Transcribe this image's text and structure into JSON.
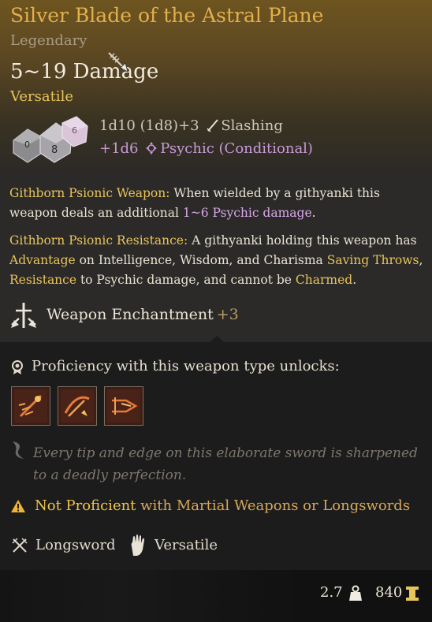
{
  "header": {
    "title": "Silver Blade of the Astral Plane",
    "rarity": "Legendary",
    "damage": "5~19 Damage",
    "tag": "Versatile",
    "damage_line1": {
      "dice": "1d10 (1d8)+3",
      "type": "Slashing"
    },
    "damage_line2": {
      "dice": "+1d6",
      "type": "Psychic (Conditional)"
    }
  },
  "passive1": {
    "name": "Githborn Psionic Weapon:",
    "text_a": " When wielded by a githyanki this weapon deals an additional ",
    "highlight": "1~6 Psychic damage",
    "text_b": "."
  },
  "passive2": {
    "name": "Githborn Psionic Resistance:",
    "text_a": " A githyanki holding this weapon has ",
    "kw_advantage": "Advantage",
    "text_b": " on Intelligence, Wisdom, and Charisma ",
    "kw_saving": "Saving Throws",
    "text_c": ", ",
    "kw_resistance": "Resistance",
    "text_d": " to Psychic damage, and cannot be ",
    "kw_charmed": "Charmed",
    "text_e": "."
  },
  "enchantment": {
    "label": "Weapon Enchantment",
    "value": "+3"
  },
  "proficiency": {
    "label": "Proficiency with this weapon type unlocks:",
    "actions": [
      "weapon-action-1-icon",
      "weapon-action-2-icon",
      "weapon-action-3-icon"
    ]
  },
  "flavor": "Every tip and edge on this elaborate sword is sharpened to a deadly perfection.",
  "warning": {
    "part1": "Not Proficient",
    "part2": " with Martial Weapons or Longswords"
  },
  "properties": {
    "type": "Longsword",
    "trait": "Versatile"
  },
  "footer": {
    "weight": "2.7",
    "price": "840"
  },
  "colors": {
    "title": "#e2b04c",
    "keyword": "#e8c45c",
    "psychic": "#c89ad8",
    "warning": "#f0c44c"
  }
}
